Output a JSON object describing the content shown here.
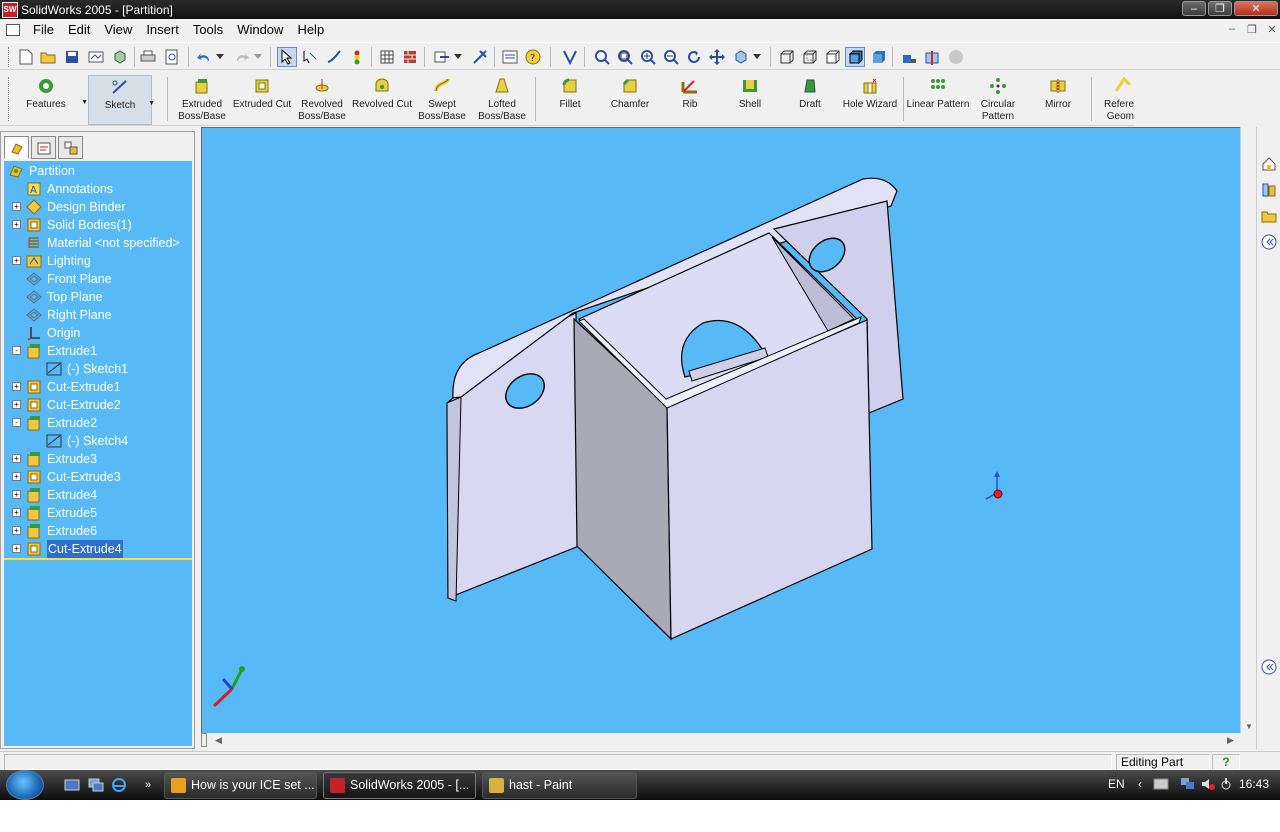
{
  "window": {
    "title": "SolidWorks 2005 - [Partition]",
    "app_icon_text": "SW"
  },
  "menu": {
    "items": [
      "File",
      "Edit",
      "View",
      "Insert",
      "Tools",
      "Window",
      "Help"
    ]
  },
  "feature_toolbar": {
    "command_groups": [
      {
        "label": "Features"
      },
      {
        "label": "Sketch"
      }
    ],
    "buttons": [
      {
        "label": "Extruded Boss/Base"
      },
      {
        "label": "Extruded Cut"
      },
      {
        "label": "Revolved Boss/Base"
      },
      {
        "label": "Revolved Cut"
      },
      {
        "label": "Swept Boss/Base"
      },
      {
        "label": "Lofted Boss/Base"
      },
      {
        "label": "Fillet"
      },
      {
        "label": "Chamfer"
      },
      {
        "label": "Rib"
      },
      {
        "label": "Shell"
      },
      {
        "label": "Draft"
      },
      {
        "label": "Hole Wizard"
      },
      {
        "label": "Linear Pattern"
      },
      {
        "label": "Circular Pattern"
      },
      {
        "label": "Mirror"
      },
      {
        "label": "Refere Geom"
      }
    ]
  },
  "feature_tree": {
    "root": "Partition",
    "items": [
      {
        "label": "Annotations",
        "icon": "annotations-icon",
        "expander": ""
      },
      {
        "label": "Design Binder",
        "icon": "design-binder-icon",
        "expander": "+"
      },
      {
        "label": "Solid Bodies(1)",
        "icon": "solid-bodies-icon",
        "expander": "+"
      },
      {
        "label": "Material <not specified>",
        "icon": "material-icon",
        "expander": ""
      },
      {
        "label": "Lighting",
        "icon": "lighting-icon",
        "expander": "+"
      },
      {
        "label": "Front Plane",
        "icon": "plane-icon",
        "expander": ""
      },
      {
        "label": "Top Plane",
        "icon": "plane-icon",
        "expander": ""
      },
      {
        "label": "Right Plane",
        "icon": "plane-icon",
        "expander": ""
      },
      {
        "label": "Origin",
        "icon": "origin-icon",
        "expander": ""
      },
      {
        "label": "Extrude1",
        "icon": "extrude-icon",
        "expander": "-"
      },
      {
        "label": "(-) Sketch1",
        "icon": "sketch-icon",
        "expander": "",
        "child": true
      },
      {
        "label": "Cut-Extrude1",
        "icon": "cut-extrude-icon",
        "expander": "+"
      },
      {
        "label": "Cut-Extrude2",
        "icon": "cut-extrude-icon",
        "expander": "+"
      },
      {
        "label": "Extrude2",
        "icon": "extrude-icon",
        "expander": "-"
      },
      {
        "label": "(-) Sketch4",
        "icon": "sketch-icon",
        "expander": "",
        "child": true
      },
      {
        "label": "Extrude3",
        "icon": "extrude-icon",
        "expander": "+"
      },
      {
        "label": "Cut-Extrude3",
        "icon": "cut-extrude-icon",
        "expander": "+"
      },
      {
        "label": "Extrude4",
        "icon": "extrude-icon",
        "expander": "+"
      },
      {
        "label": "Extrude5",
        "icon": "extrude-icon",
        "expander": "+"
      },
      {
        "label": "Extrude6",
        "icon": "extrude-icon",
        "expander": "+"
      },
      {
        "label": "Cut-Extrude4",
        "icon": "cut-extrude-icon",
        "expander": "+",
        "selected": true
      }
    ]
  },
  "status": {
    "mode": "Editing Part",
    "help_icon": "?"
  },
  "taskbar": {
    "tasks": [
      {
        "label": "How is your ICE set ...",
        "icon_color": "#e8a020"
      },
      {
        "label": "SolidWorks 2005 - [...",
        "icon_color": "#c8202a",
        "active": true
      },
      {
        "label": "hast - Paint",
        "icon_color": "#d8b040"
      }
    ],
    "language": "EN",
    "clock": "16:43"
  },
  "colors": {
    "viewport_bg": "#57baf7",
    "tree_bg": "#57baf7",
    "part_face_light": "#d8d8f2",
    "part_face_mid": "#c8c8e6",
    "part_face_dark": "#a9a9b8",
    "selection": "#2f6fc9"
  }
}
